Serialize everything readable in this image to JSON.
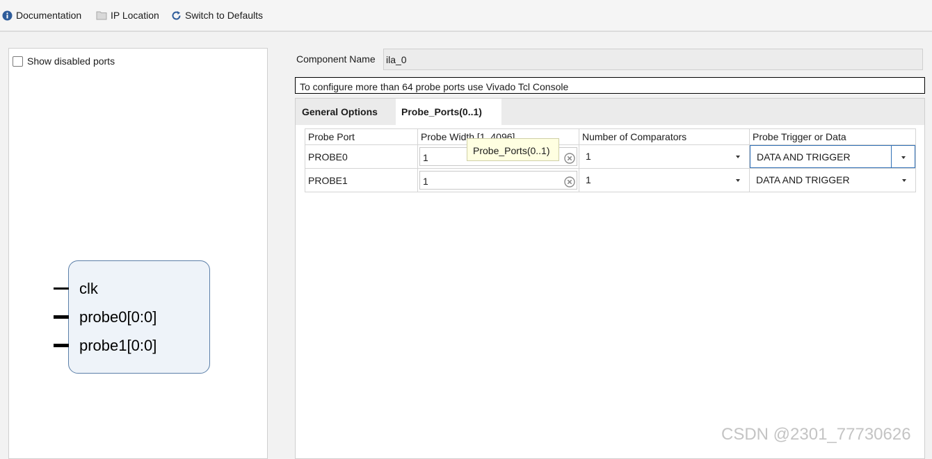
{
  "toolbar": {
    "documentation": "Documentation",
    "ip_location": "IP Location",
    "switch_defaults": "Switch to Defaults"
  },
  "left_panel": {
    "show_disabled_ports": "Show disabled ports",
    "show_disabled_checked": false,
    "pins": [
      "clk",
      "probe0[0:0]",
      "probe1[0:0]"
    ]
  },
  "component": {
    "label": "Component Name",
    "value": "ila_0"
  },
  "note": "To configure more than 64 probe ports use Vivado Tcl Console",
  "tabs": [
    "General Options",
    "Probe_Ports(0..1)"
  ],
  "active_tab": 1,
  "table": {
    "headers": [
      "Probe Port",
      "Probe Width [1..4096]",
      "Number of Comparators",
      "Probe Trigger or Data"
    ],
    "rows": [
      {
        "port": "PROBE0",
        "width": "1",
        "comparators": "1",
        "trigger": "DATA AND TRIGGER"
      },
      {
        "port": "PROBE1",
        "width": "1",
        "comparators": "1",
        "trigger": "DATA AND TRIGGER"
      }
    ]
  },
  "tooltip": "Probe_Ports(0..1)",
  "watermark": "CSDN @2301_77730626",
  "colors": {
    "symbol_fill": "#eef3f9",
    "symbol_border": "#5b7fa8",
    "focus_blue": "#2f6fb5",
    "tooltip_bg": "#ffffe1",
    "info_icon": "#2e5c9a"
  }
}
